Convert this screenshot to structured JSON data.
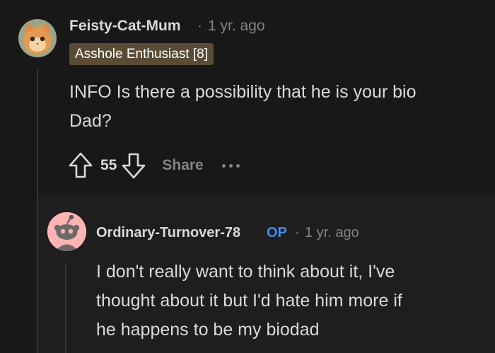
{
  "comment": {
    "username": "Feisty-Cat-Mum",
    "separator": "·",
    "time": "1 yr. ago",
    "flair": "Asshole Enthusiast [8]",
    "body_line1": "INFO Is there a possibility that he is your bio",
    "body_line2": "Dad?",
    "score": "55",
    "share_label": "Share"
  },
  "reply": {
    "username": "Ordinary-Turnover-78",
    "op_badge": "OP",
    "separator": "·",
    "time": "1 yr. ago",
    "body_line1": "I don't really want to think about it, I've",
    "body_line2": "thought about it but I'd hate him more if",
    "body_line3": "he happens to be my biodad"
  },
  "colors": {
    "background": "#181818",
    "reply_background": "#1e1e1f",
    "flair_background": "#594b35",
    "op_badge": "#4a8ae8",
    "muted_text": "#818384"
  },
  "icons": {
    "upvote": "upvote-arrow-icon",
    "downvote": "downvote-arrow-icon",
    "more": "more-dots-icon"
  }
}
